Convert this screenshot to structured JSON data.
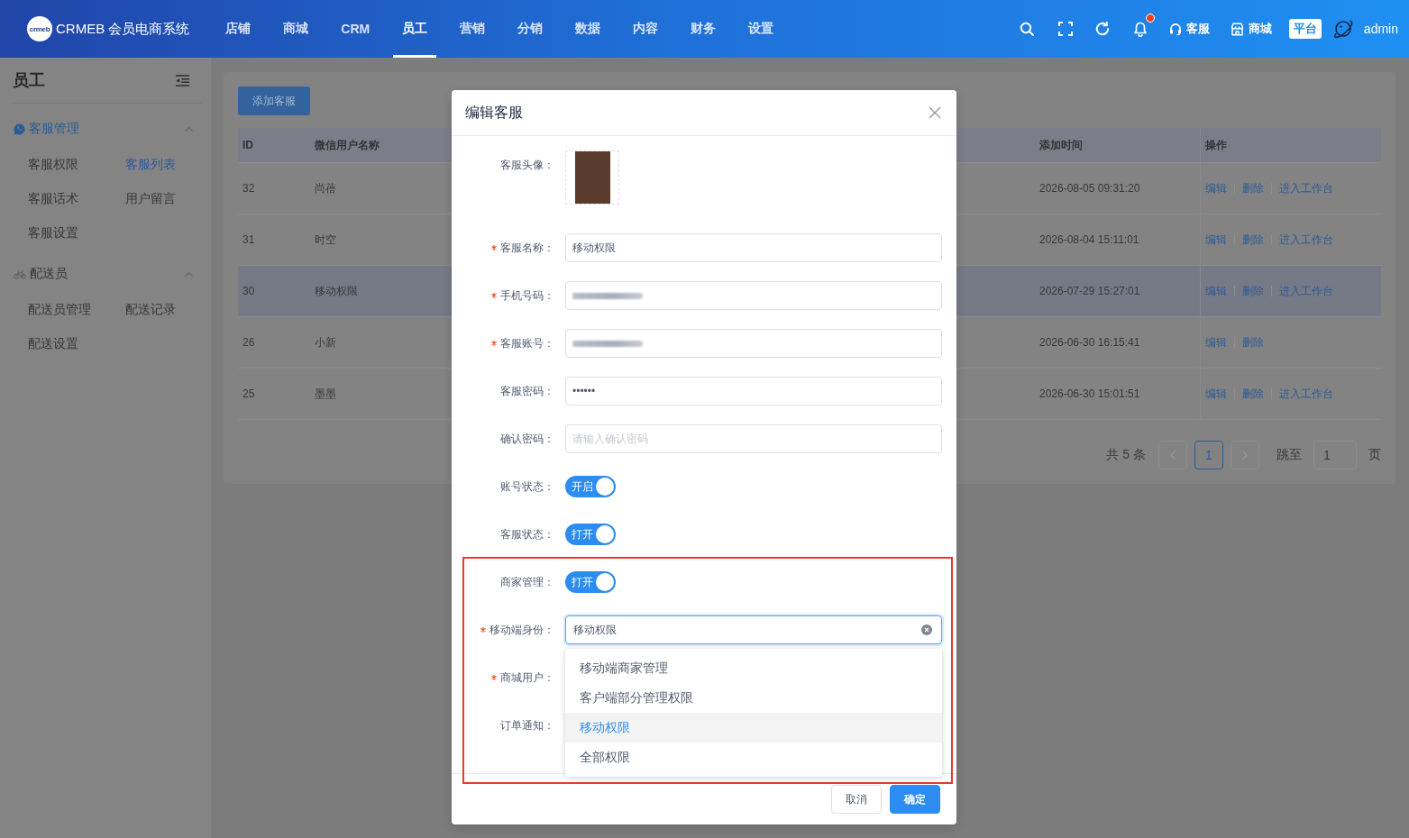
{
  "header": {
    "logo_text": "crmeb",
    "brand": "CRMEB 会员电商系统",
    "nav": [
      {
        "label": "店铺",
        "selected": false
      },
      {
        "label": "商城",
        "selected": false
      },
      {
        "label": "CRM",
        "selected": false
      },
      {
        "label": "员工",
        "selected": true
      },
      {
        "label": "营销",
        "selected": false
      },
      {
        "label": "分销",
        "selected": false
      },
      {
        "label": "数据",
        "selected": false
      },
      {
        "label": "内容",
        "selected": false
      },
      {
        "label": "财务",
        "selected": false
      },
      {
        "label": "设置",
        "selected": false
      }
    ],
    "notifications": {
      "unread": true
    },
    "links": [
      {
        "kind": "support",
        "label": "客服"
      },
      {
        "kind": "shop",
        "label": "商城"
      }
    ],
    "badge": "平台",
    "user": "admin"
  },
  "sidebar": {
    "title": "员工",
    "groups": [
      {
        "label": "客服管理",
        "kind": "chat",
        "expanded": true,
        "selected": true,
        "items": [
          {
            "label": "客服权限",
            "selected": false
          },
          {
            "label": "客服列表",
            "selected": true
          },
          {
            "label": "客服话术",
            "selected": false
          },
          {
            "label": "用户留言",
            "selected": false
          },
          {
            "label": "客服设置",
            "selected": false
          }
        ]
      },
      {
        "label": "配送员",
        "kind": "delivery",
        "expanded": true,
        "selected": false,
        "items": [
          {
            "label": "配送员管理",
            "selected": false
          },
          {
            "label": "配送记录",
            "selected": false
          },
          {
            "label": "配送设置",
            "selected": false
          }
        ]
      }
    ]
  },
  "main": {
    "add_button": "添加客服",
    "table": {
      "columns": [
        "ID",
        "微信用户名称",
        "添加时间",
        "操作"
      ],
      "rows": [
        {
          "id": "32",
          "name": "尚蓓",
          "added": "2026-08-05 09:31:20",
          "actions": [
            "编辑",
            "删除",
            "进入工作台"
          ],
          "hovered": false
        },
        {
          "id": "31",
          "name": "时空",
          "added": "2026-08-04 15:11:01",
          "actions": [
            "编辑",
            "删除",
            "进入工作台"
          ],
          "hovered": false
        },
        {
          "id": "30",
          "name": "移动权限",
          "added": "2026-07-29 15:27:01",
          "actions": [
            "编辑",
            "删除",
            "进入工作台"
          ],
          "hovered": true
        },
        {
          "id": "26",
          "name": "小新",
          "added": "2026-06-30 16:15:41",
          "actions": [
            "编辑",
            "删除"
          ],
          "hovered": false
        },
        {
          "id": "25",
          "name": "墨墨",
          "added": "2026-06-30 15:01:51",
          "actions": [
            "编辑",
            "删除",
            "进入工作台"
          ],
          "hovered": false
        }
      ]
    },
    "pagination": {
      "total": "共 5 条",
      "prev": {
        "disabled": true
      },
      "pages": [
        {
          "label": "1",
          "selected": true
        }
      ],
      "next": {
        "disabled": true
      },
      "jump_label": "跳至",
      "jump_value": "1",
      "page_suffix": "页"
    }
  },
  "modal": {
    "title": "编辑客服",
    "fields": [
      {
        "kind": "image",
        "label": "客服头像：",
        "required": false,
        "highlighted": false
      },
      {
        "kind": "text",
        "label": "客服名称：",
        "required": true,
        "value": "移动权限",
        "blurred": false,
        "highlighted": false
      },
      {
        "kind": "text",
        "label": "手机号码：",
        "required": true,
        "blurred": true,
        "highlighted": false
      },
      {
        "kind": "text",
        "label": "客服账号：",
        "required": true,
        "blurred": true,
        "highlighted": false
      },
      {
        "kind": "text",
        "label": "客服密码：",
        "required": false,
        "value": "••••••",
        "blurred": false,
        "highlighted": false
      },
      {
        "kind": "text",
        "label": "确认密码：",
        "required": false,
        "placeholder": "请输入确认密码",
        "blurred": false,
        "highlighted": false
      },
      {
        "kind": "switch",
        "label": "账号状态：",
        "required": false,
        "on": true,
        "text": "开启",
        "highlighted": false
      },
      {
        "kind": "switch",
        "label": "客服状态：",
        "required": false,
        "on": true,
        "text": "打开",
        "highlighted": false
      },
      {
        "kind": "switch",
        "label": "商家管理：",
        "required": false,
        "on": true,
        "text": "打开",
        "highlighted": true
      },
      {
        "kind": "select",
        "label": "移动端身份：",
        "required": true,
        "value": "移动权限",
        "focused": true,
        "open": true,
        "options": [
          {
            "label": "移动端商家管理",
            "selected": false
          },
          {
            "label": "客户端部分管理权限",
            "selected": false
          },
          {
            "label": "移动权限",
            "selected": true
          },
          {
            "label": "全部权限",
            "selected": false
          }
        ],
        "highlighted": true
      },
      {
        "kind": "covered",
        "label": "商城用户：",
        "required": true,
        "highlighted": true
      },
      {
        "kind": "covered",
        "label": "订单通知：",
        "required": false,
        "highlighted": true
      }
    ],
    "buttons": [
      {
        "label": "取消",
        "kind": "default"
      },
      {
        "label": "确定",
        "kind": "primary"
      }
    ]
  }
}
